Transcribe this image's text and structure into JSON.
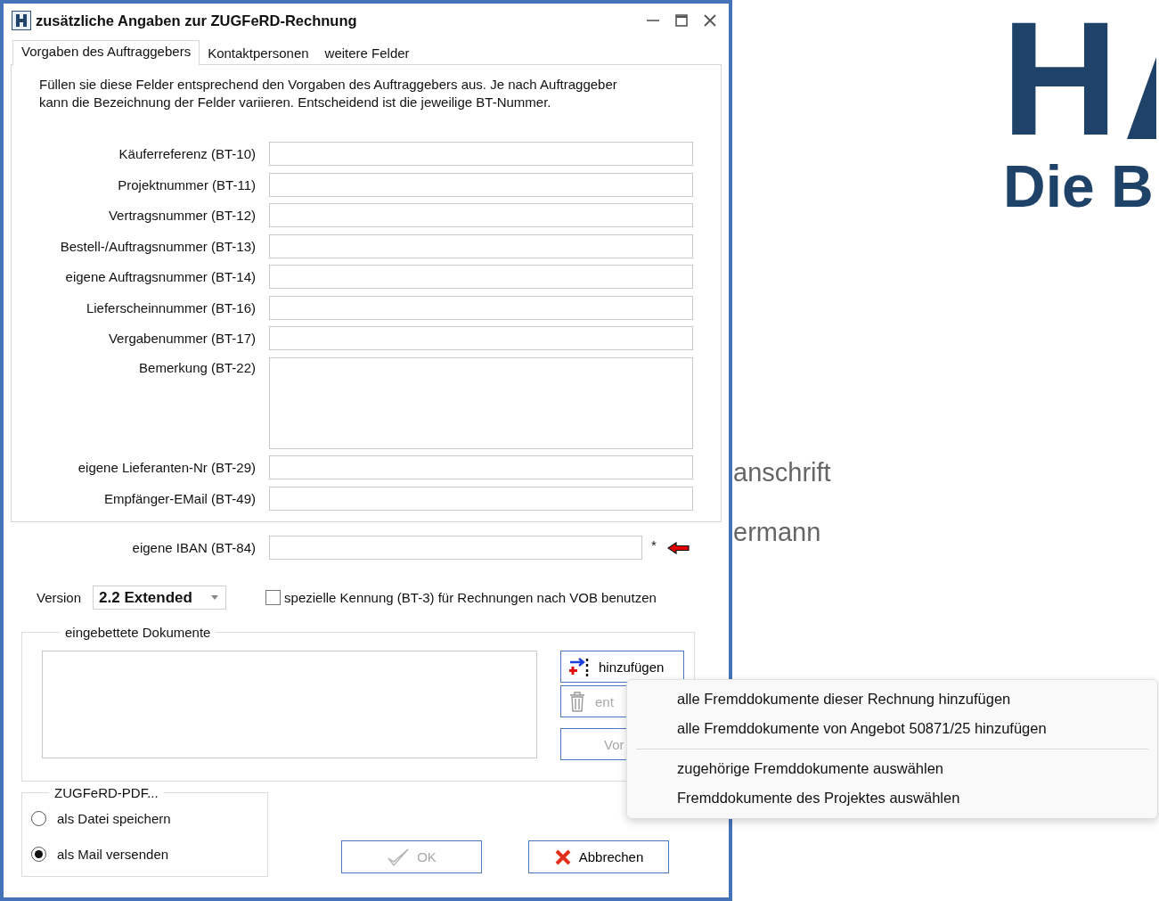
{
  "window": {
    "title": "zusätzliche Angaben zur ZUGFeRD-Rechnung"
  },
  "tabs": [
    {
      "label": "Vorgaben des Auftraggebers",
      "selected": true
    },
    {
      "label": "Kontaktpersonen",
      "selected": false
    },
    {
      "label": "weitere Felder",
      "selected": false
    }
  ],
  "intro": "Füllen sie diese Felder entsprechend den Vorgaben des Auftraggebers aus. Je nach Auftraggeber\nkann die Bezeichnung der Felder variieren. Entscheidend ist die jeweilige BT-Nummer.",
  "fields": [
    {
      "label": "Käuferreferenz (BT-10)",
      "kind": "line"
    },
    {
      "label": "Projektnummer (BT-11)",
      "kind": "line"
    },
    {
      "label": "Vertragsnummer (BT-12)",
      "kind": "line"
    },
    {
      "label": "Bestell-/Auftragsnummer (BT-13)",
      "kind": "line"
    },
    {
      "label": "eigene Auftragsnummer (BT-14)",
      "kind": "line"
    },
    {
      "label": "Lieferscheinnummer (BT-16)",
      "kind": "line"
    },
    {
      "label": "Vergabenummer (BT-17)",
      "kind": "line"
    },
    {
      "label": "Bemerkung (BT-22)",
      "kind": "multiline"
    },
    {
      "label": "eigene Lieferanten-Nr (BT-29)",
      "kind": "line"
    },
    {
      "label": "Empfänger-EMail (BT-49)",
      "kind": "line"
    }
  ],
  "iban": {
    "label": "eigene IBAN (BT-84)",
    "required_mark": "*"
  },
  "version": {
    "label": "Version",
    "value": "2.2 Extended"
  },
  "vob_checkbox": {
    "label": "spezielle Kennung (BT-3) für Rechnungen nach VOB benutzen",
    "checked": false
  },
  "documents": {
    "title": "eingebettete Dokumente",
    "buttons": [
      {
        "label": "hinzufügen",
        "kind": "add",
        "disabled": false
      },
      {
        "label": "ent",
        "kind": "remove",
        "disabled": true
      },
      {
        "label": "Vor",
        "kind": "plain",
        "disabled": true
      }
    ]
  },
  "pdf_output": {
    "title": "ZUGFeRD-PDF...",
    "options": [
      {
        "label": "als Datei speichern",
        "selected": false
      },
      {
        "label": "als Mail versenden",
        "selected": true
      }
    ]
  },
  "buttons": [
    {
      "label": "OK",
      "kind": "ok",
      "disabled": true
    },
    {
      "label": "Abbrechen",
      "kind": "cancel",
      "disabled": false
    }
  ],
  "context_menu": {
    "groups": [
      [
        "alle Fremddokumente dieser Rechnung hinzufügen",
        "alle Fremddokumente von Angebot 50871/25 hinzufügen"
      ],
      [
        "zugehörige Fremddokumente auswählen",
        "Fremddokumente des Projektes auswählen"
      ]
    ]
  },
  "background": {
    "logo_letter": "H",
    "logo_subtitle": "Die B",
    "fragments": [
      "anschrift",
      "ermann"
    ]
  }
}
